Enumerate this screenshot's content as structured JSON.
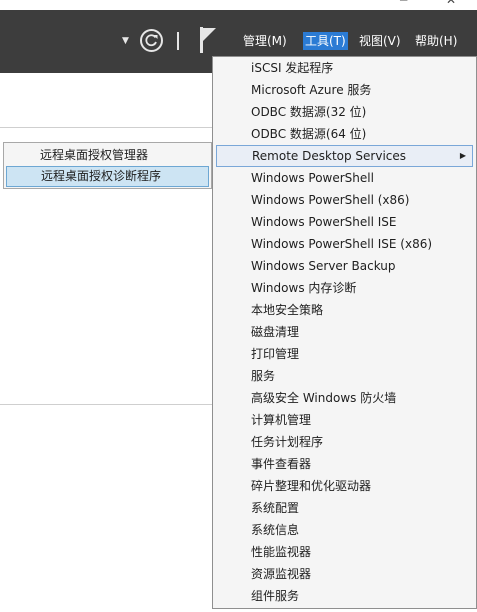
{
  "window": {
    "minimize_glyph": "─",
    "close_glyph": "✕"
  },
  "header": {
    "menus": [
      {
        "label": "管理(M)"
      },
      {
        "label": "工具(T)",
        "active": true
      },
      {
        "label": "视图(V)"
      },
      {
        "label": "帮助(H)"
      }
    ]
  },
  "submenu": {
    "items": [
      {
        "label": "远程桌面授权管理器"
      },
      {
        "label": "远程桌面授权诊断程序",
        "highlighted": true
      }
    ]
  },
  "tools_menu": {
    "items": [
      {
        "label": "iSCSI 发起程序"
      },
      {
        "label": "Microsoft Azure 服务"
      },
      {
        "label": "ODBC 数据源(32 位)"
      },
      {
        "label": "ODBC 数据源(64 位)"
      },
      {
        "label": "Remote Desktop Services",
        "has_submenu": true,
        "highlighted": true
      },
      {
        "label": "Windows PowerShell"
      },
      {
        "label": "Windows PowerShell (x86)"
      },
      {
        "label": "Windows PowerShell ISE"
      },
      {
        "label": "Windows PowerShell ISE (x86)"
      },
      {
        "label": "Windows Server Backup"
      },
      {
        "label": "Windows 内存诊断"
      },
      {
        "label": "本地安全策略"
      },
      {
        "label": "磁盘清理"
      },
      {
        "label": "打印管理"
      },
      {
        "label": "服务"
      },
      {
        "label": "高级安全 Windows 防火墙"
      },
      {
        "label": "计算机管理"
      },
      {
        "label": "任务计划程序"
      },
      {
        "label": "事件查看器"
      },
      {
        "label": "碎片整理和优化驱动器"
      },
      {
        "label": "系统配置"
      },
      {
        "label": "系统信息"
      },
      {
        "label": "性能监视器"
      },
      {
        "label": "资源监视器"
      },
      {
        "label": "组件服务"
      }
    ]
  },
  "colors": {
    "header_bg": "#3d3d3d",
    "menu_active": "#2b7bd4",
    "highlight_bg": "#cde4f3"
  }
}
